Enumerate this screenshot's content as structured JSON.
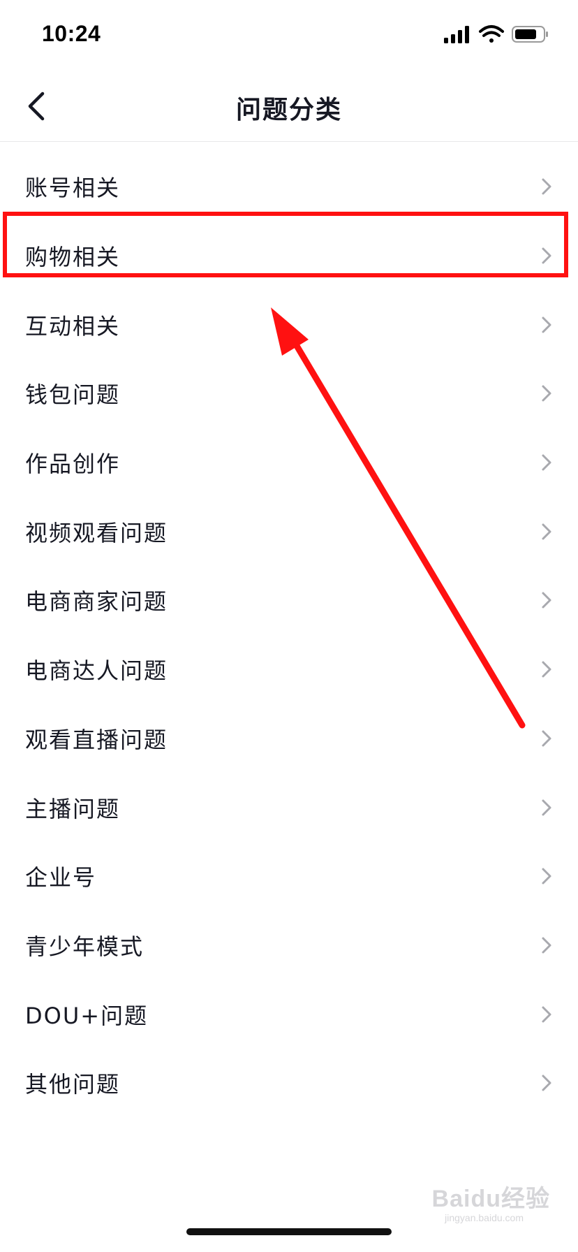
{
  "status_bar": {
    "time": "10:24",
    "icons": [
      "cellular-signal-icon",
      "wifi-icon",
      "battery-icon"
    ]
  },
  "nav": {
    "title": "问题分类",
    "back_icon": "chevron-left-icon"
  },
  "categories": [
    {
      "label": "账号相关"
    },
    {
      "label": "购物相关"
    },
    {
      "label": "互动相关"
    },
    {
      "label": "钱包问题"
    },
    {
      "label": "作品创作"
    },
    {
      "label": "视频观看问题"
    },
    {
      "label": "电商商家问题"
    },
    {
      "label": "电商达人问题"
    },
    {
      "label": "观看直播问题"
    },
    {
      "label": "主播问题"
    },
    {
      "label": "企业号"
    },
    {
      "label": "青少年模式"
    },
    {
      "label": "DOU+问题"
    },
    {
      "label": "其他问题"
    }
  ],
  "annotation": {
    "highlighted_item": "购物相关",
    "color": "#ff1111"
  },
  "watermark": {
    "text": "Baidu经验",
    "sub": "jingyan.baidu.com"
  },
  "colors": {
    "text": "#161823",
    "chevron": "#a8a9ae",
    "divider": "#e8e8ea"
  }
}
